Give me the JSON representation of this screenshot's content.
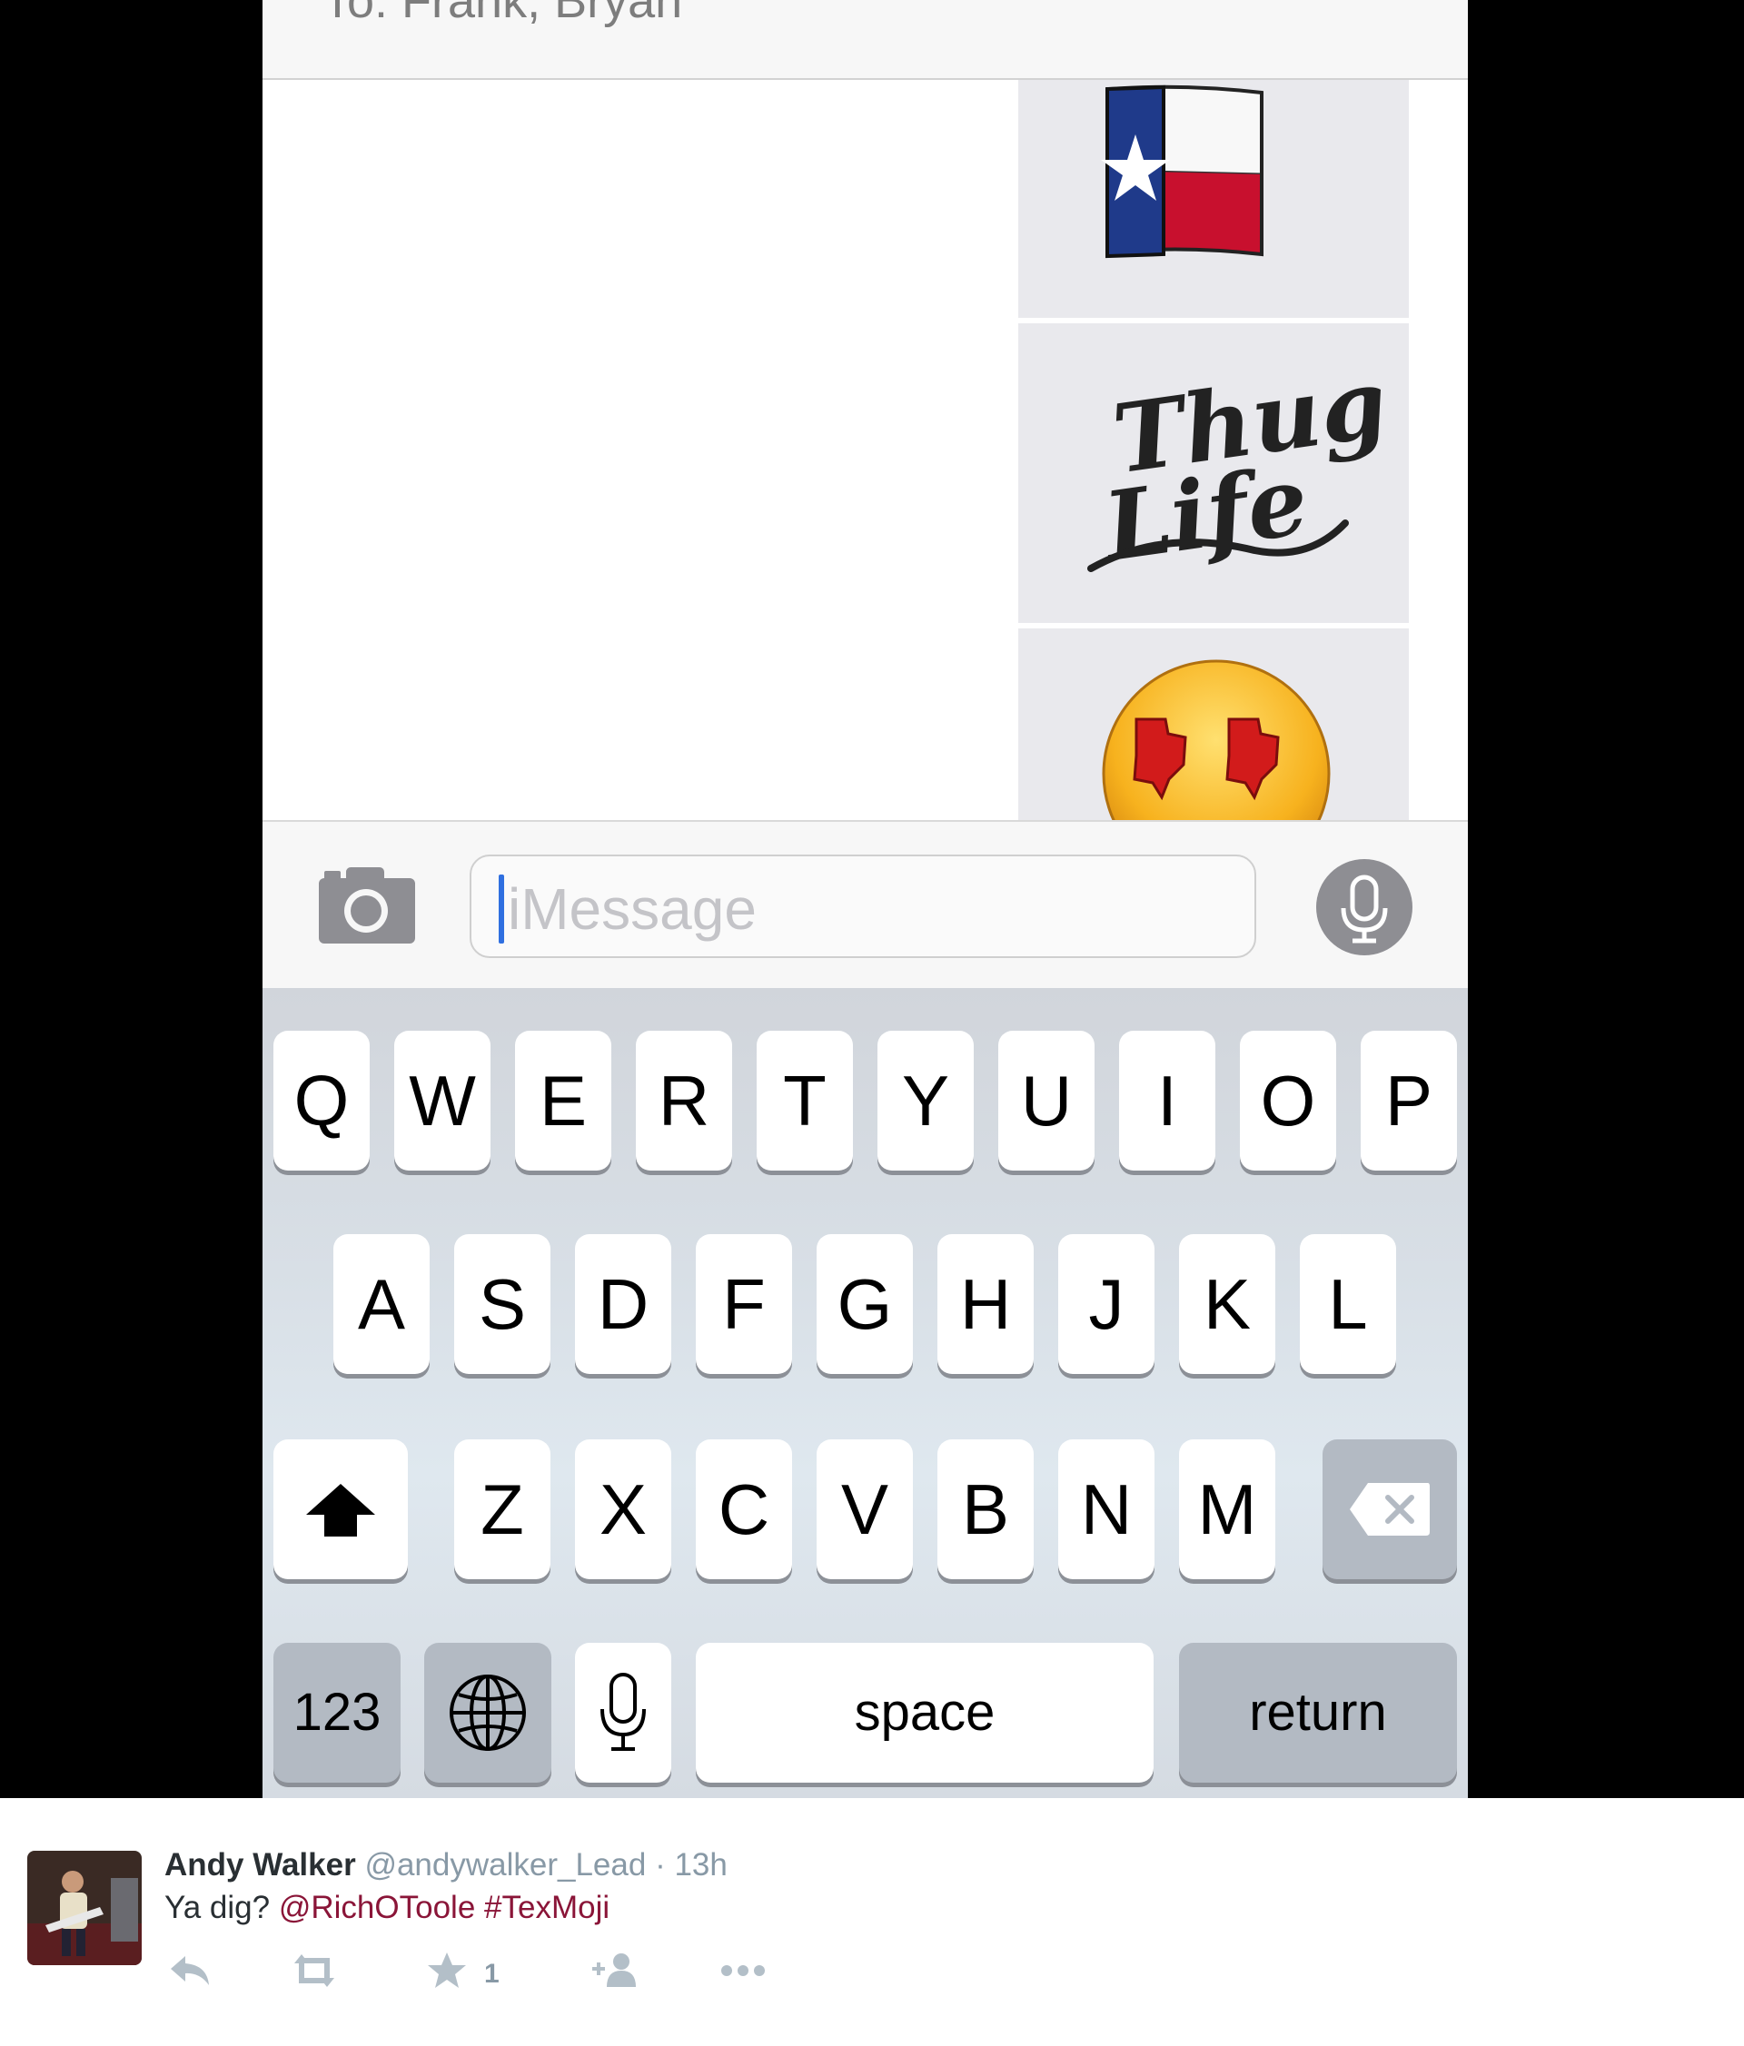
{
  "messages": {
    "header_text": "To: Frank, Bryan",
    "stickers": [
      {
        "name": "texas-flag-sticker"
      },
      {
        "name": "thug-life-sticker",
        "text": [
          "Thug",
          "Life"
        ]
      },
      {
        "name": "texas-eyes-face-sticker"
      }
    ],
    "compose": {
      "placeholder": "iMessage",
      "camera_icon": "camera-icon",
      "dictation_icon": "microphone-icon"
    }
  },
  "keyboard": {
    "row1": [
      "Q",
      "W",
      "E",
      "R",
      "T",
      "Y",
      "U",
      "I",
      "O",
      "P"
    ],
    "row2": [
      "A",
      "S",
      "D",
      "F",
      "G",
      "H",
      "J",
      "K",
      "L"
    ],
    "row3": [
      "Z",
      "X",
      "C",
      "V",
      "B",
      "N",
      "M"
    ],
    "shift_icon": "shift-arrow-icon",
    "delete_icon": "delete-backspace-icon",
    "numbers_label": "123",
    "globe_icon": "globe-icon",
    "mic_icon": "microphone-icon",
    "space_label": "space",
    "return_label": "return"
  },
  "tweet": {
    "name": "Andy Walker",
    "handle": "@andywalker_Lead",
    "separator": "·",
    "time": "13h",
    "text_prefix": "Ya dig?",
    "mention": "@RichOToole",
    "hashtag": "#TexMoji",
    "favorite_count": "1",
    "actions": [
      "reply-icon",
      "retweet-icon",
      "favorite-icon",
      "follow-icon",
      "more-icon"
    ],
    "link_color": "#8a1538"
  }
}
